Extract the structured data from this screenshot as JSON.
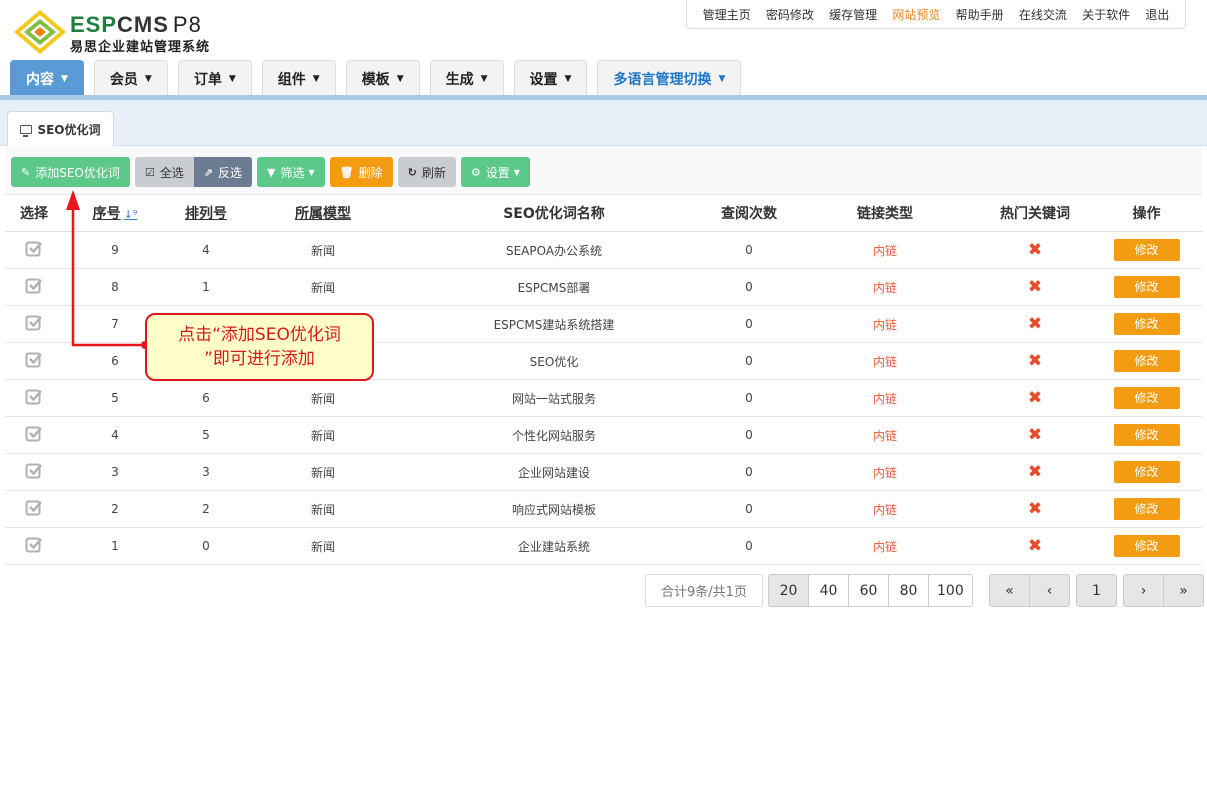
{
  "brand": {
    "name_left": "ESP",
    "name_right": "CMS",
    "version": "P8",
    "subtitle": "易思企业建站管理系统"
  },
  "topnav": [
    "管理主页",
    "密码修改",
    "缓存管理",
    "网站预览",
    "帮助手册",
    "在线交流",
    "关于软件",
    "退出"
  ],
  "topnav_highlight": "网站预览",
  "mainnav": [
    "内容",
    "会员",
    "订单",
    "组件",
    "模板",
    "生成",
    "设置",
    "多语言管理切换"
  ],
  "subtab": "SEO优化词",
  "toolbar": {
    "add": "添加SEO优化词",
    "select_all": "全选",
    "invert": "反选",
    "filter": "筛选",
    "delete": "删除",
    "refresh": "刷新",
    "settings": "设置"
  },
  "table": {
    "headers": [
      "选择",
      "序号",
      "排列号",
      "所属模型",
      "SEO优化词名称",
      "查阅次数",
      "链接类型",
      "热门关键词",
      "操作"
    ],
    "rows": [
      {
        "id": "9",
        "order": "4",
        "model": "新闻",
        "name": "SEAPOA办公系统",
        "views": "0",
        "link": "内链",
        "action": "修改"
      },
      {
        "id": "8",
        "order": "1",
        "model": "新闻",
        "name": "ESPCMS部署",
        "views": "0",
        "link": "内链",
        "action": "修改"
      },
      {
        "id": "7",
        "order": "",
        "model": "",
        "name": "ESPCMS建站系统搭建",
        "views": "0",
        "link": "内链",
        "action": "修改"
      },
      {
        "id": "6",
        "order": "",
        "model": "",
        "name": "SEO优化",
        "views": "0",
        "link": "内链",
        "action": "修改"
      },
      {
        "id": "5",
        "order": "6",
        "model": "新闻",
        "name": "网站一站式服务",
        "views": "0",
        "link": "内链",
        "action": "修改"
      },
      {
        "id": "4",
        "order": "5",
        "model": "新闻",
        "name": "个性化网站服务",
        "views": "0",
        "link": "内链",
        "action": "修改"
      },
      {
        "id": "3",
        "order": "3",
        "model": "新闻",
        "name": "企业网站建设",
        "views": "0",
        "link": "内链",
        "action": "修改"
      },
      {
        "id": "2",
        "order": "2",
        "model": "新闻",
        "name": "响应式网站模板",
        "views": "0",
        "link": "内链",
        "action": "修改"
      },
      {
        "id": "1",
        "order": "0",
        "model": "新闻",
        "name": "企业建站系统",
        "views": "0",
        "link": "内链",
        "action": "修改"
      }
    ]
  },
  "pagination": {
    "total": "合计9条/共1页",
    "sizes": [
      "20",
      "40",
      "60",
      "80",
      "100"
    ],
    "active_size": "20",
    "current_page": "1"
  },
  "callout": {
    "line1": "点击“添加SEO优化词",
    "line2": "”即可进行添加"
  },
  "colors": {
    "green": "#5cc88a",
    "orange": "#f39c12",
    "blue": "#5b9bd5",
    "red": "#d9171e"
  }
}
